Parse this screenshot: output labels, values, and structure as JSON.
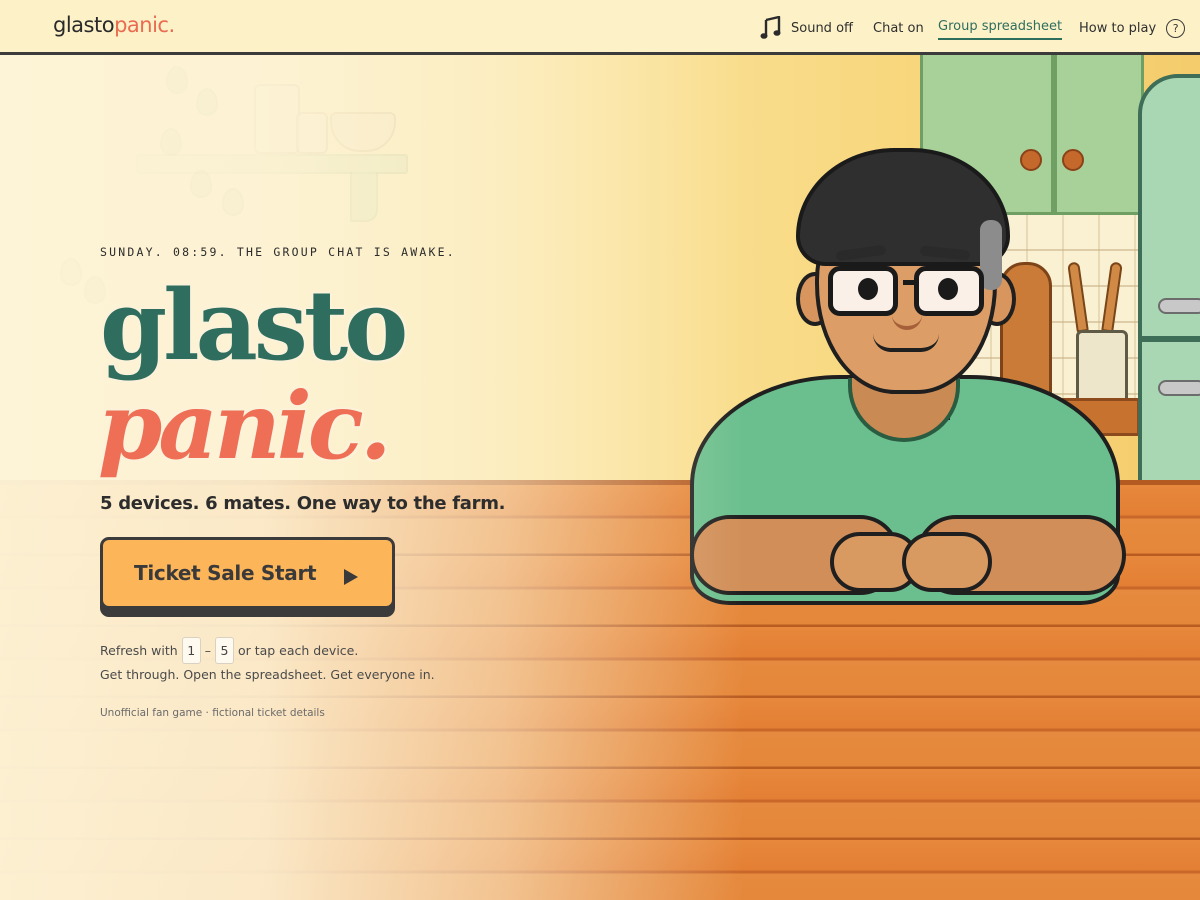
{
  "header": {
    "logo_part1": "glasto",
    "logo_part2": "panic.",
    "nav": {
      "sound_label": "Sound off",
      "chat_label": "Chat on",
      "spreadsheet_label": "Group spreadsheet",
      "howto_label": "How to play",
      "help_glyph": "?"
    }
  },
  "hero": {
    "kicker": "SUNDAY. 08:59. THE GROUP CHAT IS AWAKE.",
    "title_line1": "glasto",
    "title_line2": "panic.",
    "tagline": "5 devices. 6 mates. One way to the farm.",
    "cta_label": "Ticket Sale Start",
    "hint_prefix": "Refresh with",
    "hint_key_start": "1",
    "hint_dash": "–",
    "hint_key_end": "5",
    "hint_suffix": "or tap each device.",
    "hint_line2": "Get through. Open the spreadsheet. Get everyone in.",
    "disclaimer": "Unofficial fan game · fictional ticket details"
  },
  "icons": {
    "sound": "music-note-icon",
    "help": "question-circle-icon",
    "cta": "play-icon"
  },
  "colors": {
    "header_bg": "#fdf1c8",
    "title_green": "#2f6e5e",
    "title_coral": "#ee6f55",
    "cta_fill": "#fdb559",
    "link_active": "#2e6e5d"
  }
}
